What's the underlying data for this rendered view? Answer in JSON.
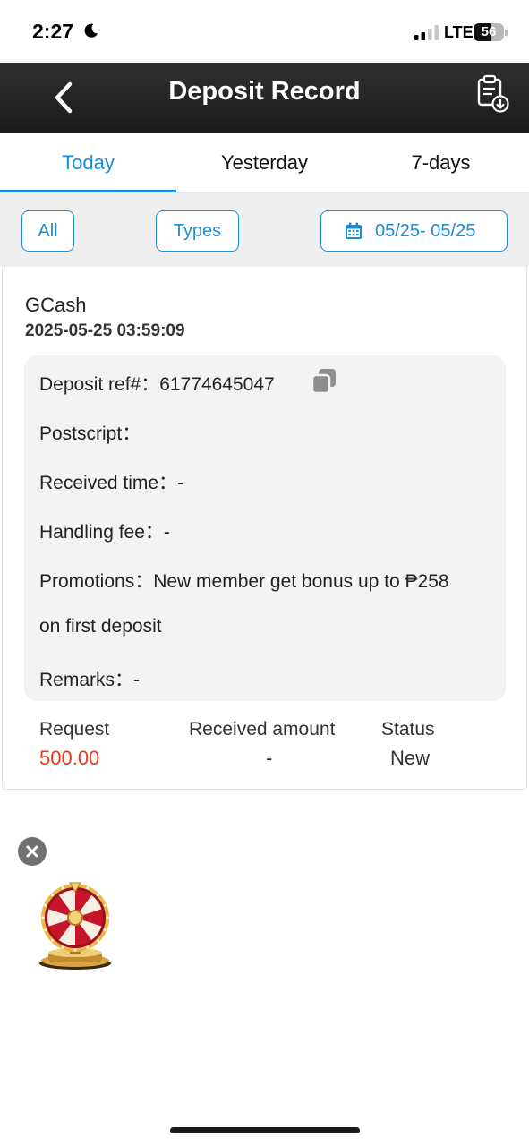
{
  "status_bar": {
    "time": "2:27",
    "network": "LTE",
    "battery": "56",
    "battery_level": 0.56
  },
  "header": {
    "title": "Deposit Record",
    "back_icon": "chevron-left-icon",
    "record_icon": "clipboard-download-icon"
  },
  "tabs": [
    {
      "label": "Today",
      "active": true
    },
    {
      "label": "Yesterday",
      "active": false
    },
    {
      "label": "7-days",
      "active": false
    }
  ],
  "filters": {
    "all_label": "All",
    "types_label": "Types",
    "date_range": "05/25- 05/25",
    "date_icon": "calendar-icon"
  },
  "record": {
    "method": "GCash",
    "datetime": "2025-05-25 03:59:09",
    "deposit_ref": "Deposit ref#：61774645047",
    "postscript": "Postscript：",
    "received_time": "Received time：-",
    "handling_fee": "Handling fee：-",
    "promotions_line1": "Promotions：New member get bonus up to ₱258",
    "promotions_line2": "on first deposit",
    "remarks": "Remarks：-",
    "request_label": "Request",
    "request_value": "500.00",
    "received_amount_label": "Received amount",
    "received_amount_value": "-",
    "status_label": "Status",
    "status_value": "New"
  },
  "colors": {
    "accent": "#1e8bd6",
    "amount_red": "#e8381a",
    "header_bg": "#262626"
  }
}
